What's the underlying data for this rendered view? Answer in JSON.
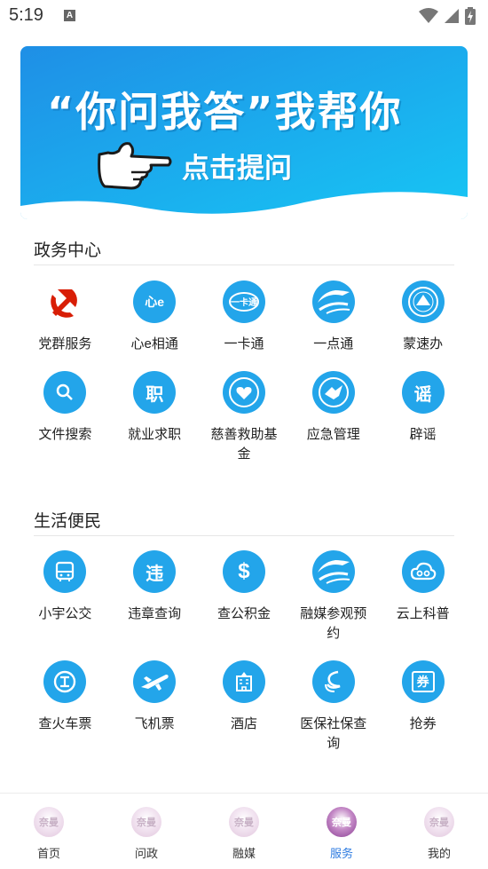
{
  "status_bar": {
    "time": "5:19",
    "notification": "A"
  },
  "banner": {
    "title": "“你问我答”我帮你",
    "subtitle": "点击提问",
    "colors": {
      "top": "#1f9ae8",
      "bottom": "#16c3f3"
    }
  },
  "sections": [
    {
      "title": "政务中心",
      "items": [
        {
          "label": "党群服务",
          "icon": "party-emblem-icon"
        },
        {
          "label": "心e相通",
          "icon": "xin-e-xiangtong-icon",
          "glyph": "心e"
        },
        {
          "label": "一卡通",
          "icon": "card-icon",
          "glyph": "一卡通"
        },
        {
          "label": "一点通",
          "icon": "wave-logo-icon"
        },
        {
          "label": "蒙速办",
          "icon": "mengsuban-emblem-icon"
        },
        {
          "label": "文件搜索",
          "icon": "search-icon"
        },
        {
          "label": "就业求职",
          "icon": "job-icon",
          "glyph": "职"
        },
        {
          "label": "慈善救助基金",
          "icon": "charity-emblem-icon"
        },
        {
          "label": "应急管理",
          "icon": "emergency-emblem-icon"
        },
        {
          "label": "辟谣",
          "icon": "rumor-icon",
          "glyph": "谣"
        }
      ]
    },
    {
      "title": "生活便民",
      "items": [
        {
          "label": "小宇公交",
          "icon": "bus-icon"
        },
        {
          "label": "违章查询",
          "icon": "violation-icon",
          "glyph": "违"
        },
        {
          "label": "查公积金",
          "icon": "dollar-icon",
          "glyph": "$"
        },
        {
          "label": "融媒参观预约",
          "icon": "wave-logo-icon"
        },
        {
          "label": "云上科普",
          "icon": "cloud-icon"
        },
        {
          "label": "查火车票",
          "icon": "train-icon"
        },
        {
          "label": "飞机票",
          "icon": "airplane-icon"
        },
        {
          "label": "酒店",
          "icon": "hotel-icon"
        },
        {
          "label": "医保社保查询",
          "icon": "insurance-icon"
        },
        {
          "label": "抢券",
          "icon": "coupon-icon",
          "glyph": "券"
        }
      ]
    }
  ],
  "tabbar": {
    "items": [
      {
        "label": "首页",
        "active": false
      },
      {
        "label": "问政",
        "active": false
      },
      {
        "label": "融媒",
        "active": false
      },
      {
        "label": "服务",
        "active": true
      },
      {
        "label": "我的",
        "active": false
      }
    ],
    "logo_text": "奈曼",
    "active_color": "#2d7be0"
  }
}
